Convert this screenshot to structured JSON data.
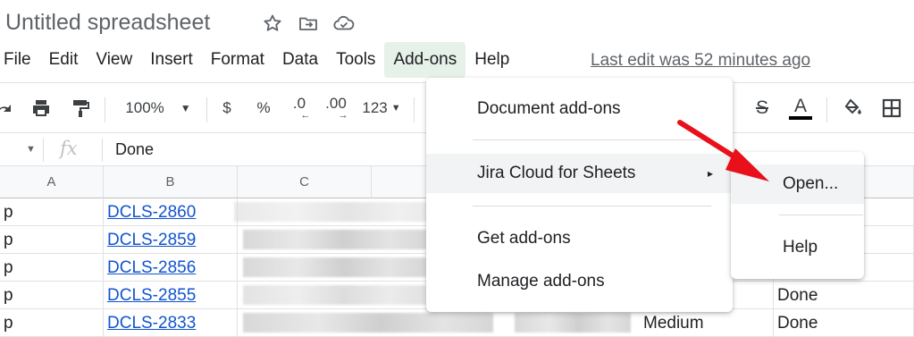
{
  "title": "Untitled spreadsheet",
  "title_icons": [
    "star-icon",
    "move-to-folder-icon",
    "cloud-status-icon"
  ],
  "menubar": {
    "items": [
      "File",
      "Edit",
      "View",
      "Insert",
      "Format",
      "Data",
      "Tools",
      "Add-ons",
      "Help"
    ],
    "active": "Add-ons",
    "last_edit": "Last edit was 52 minutes ago"
  },
  "toolbar": {
    "zoom": "100%",
    "currency": "$",
    "percent": "%",
    "decrease_decimal": ".0",
    "increase_decimal": ".00",
    "more_formats": "123",
    "strikethrough": "S",
    "text_color": "A"
  },
  "formula_bar": {
    "fx": "fx",
    "value": "Done"
  },
  "columns": [
    "A",
    "B",
    "C"
  ],
  "rows": [
    {
      "a": "p",
      "b": "DCLS-2860",
      "e": "",
      "f": ""
    },
    {
      "a": "p",
      "b": "DCLS-2859",
      "e": "",
      "f": ""
    },
    {
      "a": "p",
      "b": "DCLS-2856",
      "e": "",
      "f": ""
    },
    {
      "a": "p",
      "b": "DCLS-2855",
      "e": "",
      "f": "Done"
    },
    {
      "a": "p",
      "b": "DCLS-2833",
      "e": "Medium",
      "f": "Done"
    }
  ],
  "addons_menu": {
    "items": [
      {
        "label": "Document add-ons"
      },
      {
        "label": "Jira Cloud for Sheets",
        "submenu_arrow": "▸"
      },
      {
        "label": "Get add-ons"
      },
      {
        "label": "Manage add-ons"
      }
    ]
  },
  "jira_submenu": {
    "items": [
      "Open...",
      "Help"
    ]
  },
  "colors": {
    "link": "#1155cc",
    "active_menu_bg": "#e6f1e9",
    "annotation_arrow": "#e8101a",
    "hover_bg": "#f1f3f4"
  }
}
